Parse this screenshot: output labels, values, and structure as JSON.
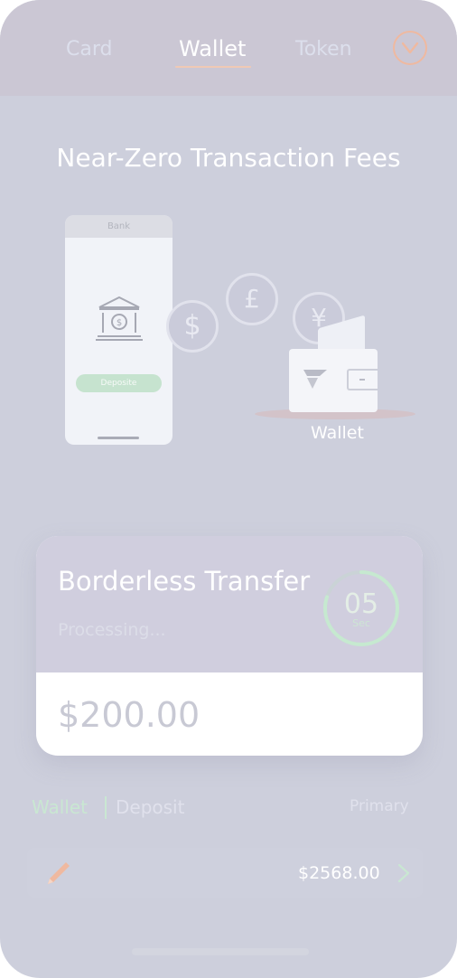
{
  "tabs": [
    {
      "label": "Card"
    },
    {
      "label": "Wallet"
    },
    {
      "label": "Token"
    }
  ],
  "headline": "Near-Zero Transaction Fees",
  "illustration": {
    "phone_header": "Bank",
    "deposit_button": "Deposite",
    "coins": [
      "$",
      "£",
      "¥"
    ],
    "wallet_label": "Wallet"
  },
  "transfer_card": {
    "title": "Borderless Transfer",
    "status": "Processing...",
    "timer_value": "05",
    "timer_unit": "Sec",
    "timer_progress": 0.8,
    "amount": "$200.00"
  },
  "balance_section": {
    "wallet_label": "Wallet",
    "deposit_label": "Deposit",
    "primary_label": "Primary",
    "amount": "$2568.00"
  },
  "colors": {
    "accent_orange": "#efb9a0",
    "accent_green": "#c9e7d2",
    "background": "#cdcfdc"
  }
}
